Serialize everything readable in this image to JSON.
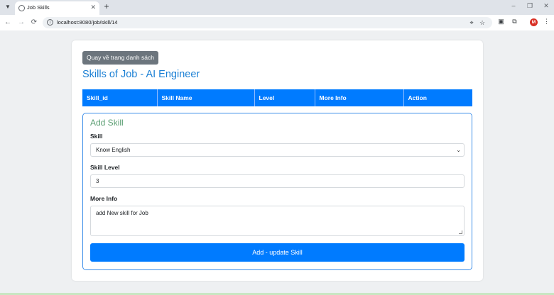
{
  "browser": {
    "tab_title": "Job Skills",
    "url": "localhost:8080/job/skill/14",
    "tab_list_icon": "chevron-down-icon",
    "profile_initial": "M"
  },
  "page": {
    "back_button": "Quay về trang danh sách",
    "title": "Skills of Job - AI Engineer",
    "table_headers": [
      "Skill_id",
      "Skill Name",
      "Level",
      "More Info",
      "Action"
    ],
    "form": {
      "legend": "Add Skill",
      "skill_label": "Skill",
      "skill_selected": "Know English",
      "level_label": "Skill Level",
      "level_value": "3",
      "info_label": "More Info",
      "info_value": "add New skill for Job",
      "submit_label": "Add - update Skill"
    }
  },
  "colors": {
    "primary": "#007bff",
    "secondary": "#6c757d",
    "title": "#1a7fd4",
    "legend": "#5a9e72"
  }
}
